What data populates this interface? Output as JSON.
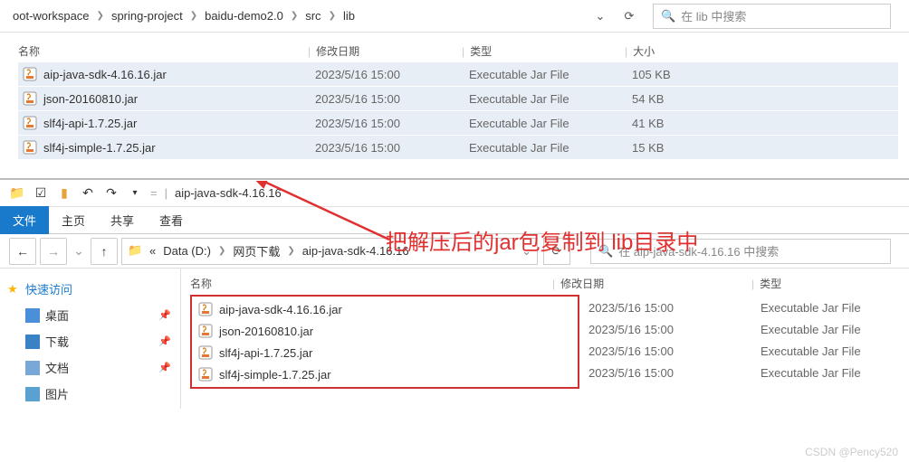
{
  "top": {
    "breadcrumb": [
      "oot-workspace",
      "spring-project",
      "baidu-demo2.0",
      "src",
      "lib"
    ],
    "search_placeholder": "在 lib 中搜索",
    "columns": {
      "name": "名称",
      "date": "修改日期",
      "type": "类型",
      "size": "大小"
    },
    "files": [
      {
        "name": "aip-java-sdk-4.16.16.jar",
        "date": "2023/5/16 15:00",
        "type": "Executable Jar File",
        "size": "105 KB"
      },
      {
        "name": "json-20160810.jar",
        "date": "2023/5/16 15:00",
        "type": "Executable Jar File",
        "size": "54 KB"
      },
      {
        "name": "slf4j-api-1.7.25.jar",
        "date": "2023/5/16 15:00",
        "type": "Executable Jar File",
        "size": "41 KB"
      },
      {
        "name": "slf4j-simple-1.7.25.jar",
        "date": "2023/5/16 15:00",
        "type": "Executable Jar File",
        "size": "15 KB"
      }
    ]
  },
  "win2": {
    "title": "aip-java-sdk-4.16.16",
    "tabs": {
      "file": "文件",
      "home": "主页",
      "share": "共享",
      "view": "查看"
    },
    "breadcrumb_prefix": "«",
    "breadcrumb": [
      "Data (D:)",
      "网页下载",
      "aip-java-sdk-4.16.16"
    ],
    "search_placeholder": "在 aip-java-sdk-4.16.16 中搜索",
    "sidebar": {
      "quick": "快速访问",
      "desktop": "桌面",
      "downloads": "下载",
      "documents": "文档",
      "pictures": "图片"
    },
    "columns": {
      "name": "名称",
      "date": "修改日期",
      "type": "类型"
    },
    "files": [
      {
        "name": "aip-java-sdk-4.16.16.jar",
        "date": "2023/5/16 15:00",
        "type": "Executable Jar File"
      },
      {
        "name": "json-20160810.jar",
        "date": "2023/5/16 15:00",
        "type": "Executable Jar File"
      },
      {
        "name": "slf4j-api-1.7.25.jar",
        "date": "2023/5/16 15:00",
        "type": "Executable Jar File"
      },
      {
        "name": "slf4j-simple-1.7.25.jar",
        "date": "2023/5/16 15:00",
        "type": "Executable Jar File"
      }
    ]
  },
  "annotation": "把解压后的jar包复制到 lib目录中",
  "watermark": "CSDN @Pency520"
}
